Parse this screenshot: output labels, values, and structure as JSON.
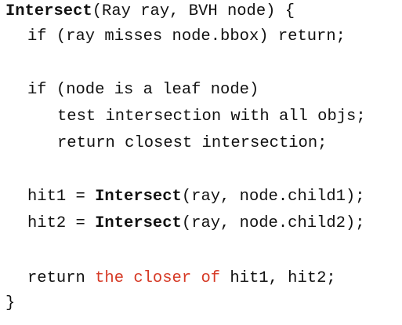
{
  "code": {
    "line1": {
      "func": "Intersect",
      "rest": "(Ray ray, BVH node) {"
    },
    "line2": {
      "text": "if (ray misses node.bbox) return;"
    },
    "line3": {
      "text": "if (node is a leaf node)"
    },
    "line4": {
      "text": "test intersection with all objs;"
    },
    "line5": {
      "text": "return closest intersection;"
    },
    "line6": {
      "pre": "hit1 = ",
      "func": "Intersect",
      "post": "(ray, node.child1);"
    },
    "line7": {
      "pre": "hit2 = ",
      "func": "Intersect",
      "post": "(ray, node.child2);"
    },
    "line8": {
      "pre": "return ",
      "highlight": "the closer of",
      "post": " hit1, hit2;"
    },
    "line9": {
      "text": "}"
    }
  },
  "colors": {
    "text": "#111111",
    "highlight": "#d63a26",
    "background": "#ffffff"
  }
}
